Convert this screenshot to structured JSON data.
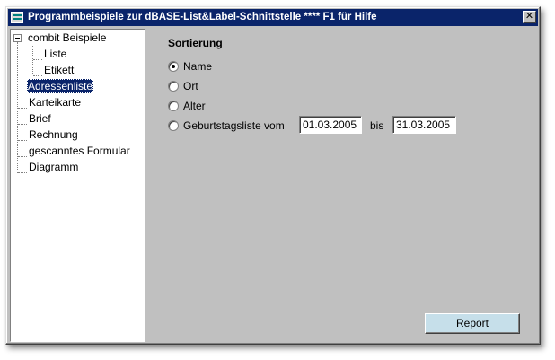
{
  "window": {
    "title": "Programmbeispiele zur dBASE-List&Label-Schnittstelle **** F1 für Hilfe",
    "close_glyph": "✕"
  },
  "tree": {
    "root": "combit Beispiele",
    "children": [
      "Liste",
      "Etikett"
    ],
    "items": [
      "Adressenliste",
      "Karteikarte",
      "Brief",
      "Rechnung",
      "gescanntes Formular",
      "Diagramm"
    ],
    "selected": "Adressenliste"
  },
  "panel": {
    "title": "Sortierung",
    "options": [
      {
        "label": "Name",
        "checked": true
      },
      {
        "label": "Ort",
        "checked": false
      },
      {
        "label": "Alter",
        "checked": false
      },
      {
        "label": "Geburtstagsliste vom",
        "checked": false
      }
    ],
    "date_from": "01.03.2005",
    "bis_label": "bis",
    "date_to": "31.03.2005"
  },
  "buttons": {
    "report": "Report"
  },
  "colors": {
    "titlebar": "#0a246a",
    "face": "#c0c0c0",
    "report_button": "#c6dfea"
  },
  "icons": {
    "app": "app-window-icon",
    "close": "close-icon",
    "expander": "tree-collapse-icon"
  }
}
